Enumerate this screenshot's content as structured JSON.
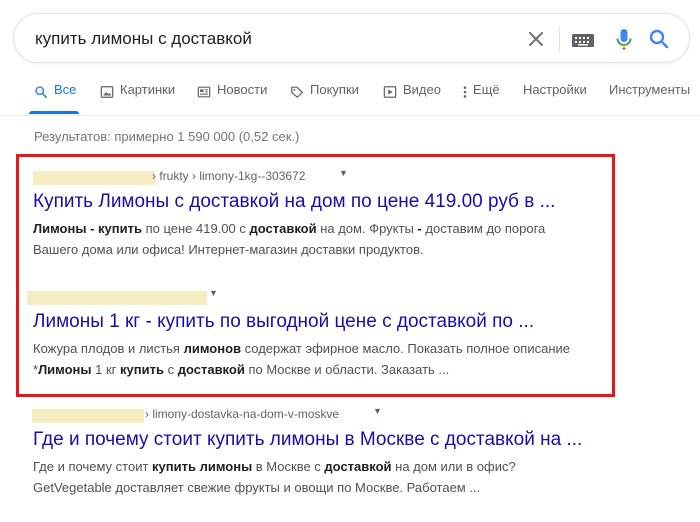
{
  "search": {
    "query": "купить лимоны с доставкой"
  },
  "icons": {
    "clear": "close-icon",
    "keyboard": "keyboard-icon",
    "mic": "microphone-icon",
    "search": "search-icon"
  },
  "tabs": [
    {
      "label": "Все",
      "icon": "search-icon",
      "active": true
    },
    {
      "label": "Картинки",
      "icon": "image-icon"
    },
    {
      "label": "Новости",
      "icon": "news-icon"
    },
    {
      "label": "Покупки",
      "icon": "tag-icon"
    },
    {
      "label": "Видео",
      "icon": "play-icon"
    },
    {
      "label": "Ещё",
      "icon": "more-vertical-icon"
    },
    {
      "label": "Настройки"
    },
    {
      "label": "Инструменты"
    }
  ],
  "stats": "Результатов: примерно 1 590 000 (0,52 сек.)",
  "colors": {
    "link": "#1a0dab",
    "accent": "#1a73e8",
    "highlight_frame": "#e8141c",
    "mask": "#f6ecc2"
  },
  "results": [
    {
      "cite": "› frukty › limony-1kg--303672",
      "title": "Купить Лимоны с доставкой на дом по цене 419.00 руб в ...",
      "snippet_lines": [
        [
          {
            "t": "Лимоны - купить",
            "b": true
          },
          {
            "t": " по цене 419.00 с ",
            "b": false
          },
          {
            "t": "доставкой",
            "b": true
          },
          {
            "t": " на дом. Фрукты ",
            "b": false
          },
          {
            "t": "-",
            "b": true
          },
          {
            "t": " доставим до порога",
            "b": false
          }
        ],
        [
          {
            "t": "Вашего дома или офиса! Интернет-магазин доставки продуктов.",
            "b": false
          }
        ]
      ]
    },
    {
      "cite": "",
      "title": "Лимоны 1 кг - купить по выгодной цене с доставкой по ...",
      "snippet_lines": [
        [
          {
            "t": "Кожура плодов и листья ",
            "b": false
          },
          {
            "t": "лимонов",
            "b": true
          },
          {
            "t": " содержат эфирное масло. Показать полное описание",
            "b": false
          }
        ],
        [
          {
            "t": "*",
            "b": false
          },
          {
            "t": "Лимоны",
            "b": true
          },
          {
            "t": " 1 кг ",
            "b": false
          },
          {
            "t": "купить",
            "b": true
          },
          {
            "t": " с ",
            "b": false
          },
          {
            "t": "доставкой",
            "b": true
          },
          {
            "t": " по Москве и области. Заказать ...",
            "b": false
          }
        ]
      ]
    },
    {
      "cite": "› limony-dostavka-na-dom-v-moskve",
      "title": "Где и почему стоит купить лимоны в Москве с доставкой на ...",
      "snippet_lines": [
        [
          {
            "t": "Где и почему стоит ",
            "b": false
          },
          {
            "t": "купить лимоны",
            "b": true
          },
          {
            "t": " в Москве с ",
            "b": false
          },
          {
            "t": "доставкой",
            "b": true
          },
          {
            "t": " на дом или в офис?",
            "b": false
          }
        ],
        [
          {
            "t": "GetVegetable доставляет свежие фрукты и овощи по Москве. Работаем ...",
            "b": false
          }
        ]
      ]
    }
  ]
}
